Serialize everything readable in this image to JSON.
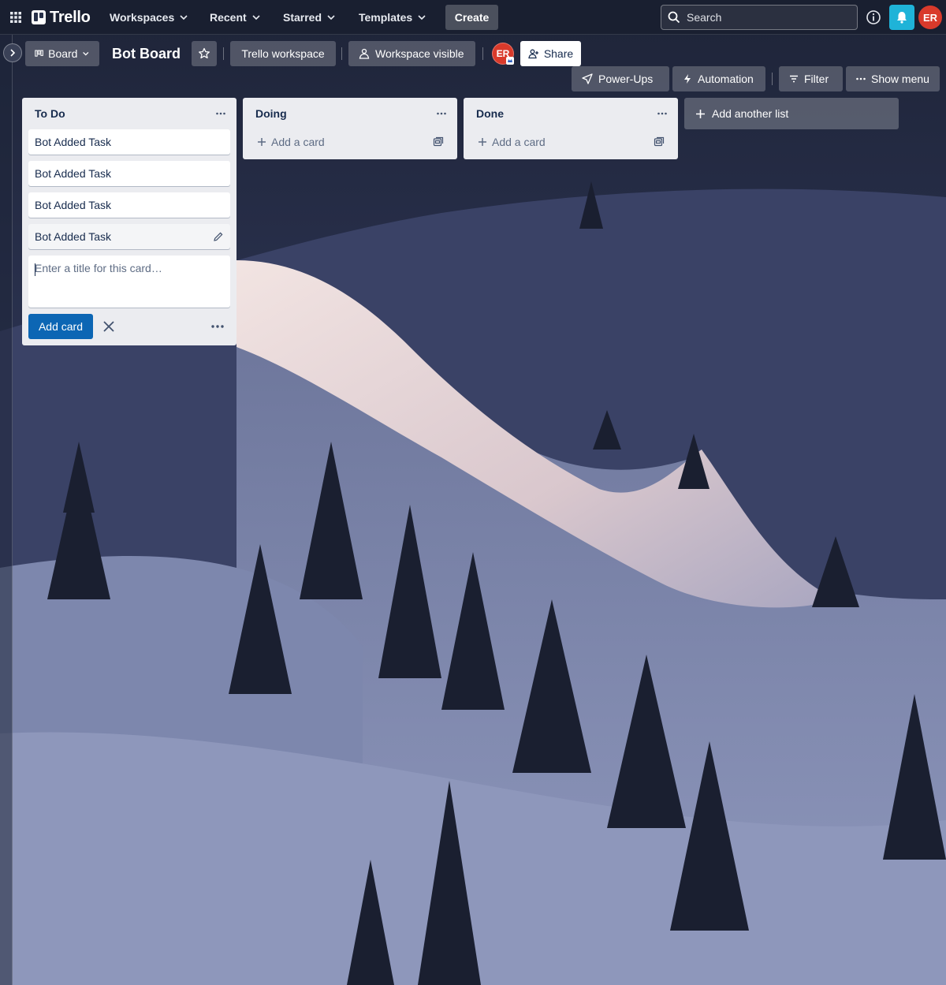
{
  "topnav": {
    "logo_text": "Trello",
    "menus": [
      {
        "label": "Workspaces"
      },
      {
        "label": "Recent"
      },
      {
        "label": "Starred"
      },
      {
        "label": "Templates"
      }
    ],
    "create_label": "Create",
    "search_placeholder": "Search",
    "user_initials": "ER",
    "notification_color": "#1fb3d8",
    "avatar_color": "#d93a2b"
  },
  "board_header": {
    "view_label": "Board",
    "board_name": "Bot Board",
    "workspace_label": "Trello workspace",
    "visibility_label": "Workspace visible",
    "member_initials": "ER",
    "share_label": "Share",
    "powerups_label": "Power-Ups",
    "automation_label": "Automation",
    "filter_label": "Filter",
    "show_menu_label": "Show menu"
  },
  "lists": [
    {
      "title": "To Do",
      "cards": [
        "Bot Added Task",
        "Bot Added Task",
        "Bot Added Task",
        "Bot Added Task"
      ],
      "composer_placeholder": "Enter a title for this card…",
      "add_card_button": "Add card"
    },
    {
      "title": "Doing",
      "add_card_label": "Add a card"
    },
    {
      "title": "Done",
      "add_card_label": "Add a card"
    }
  ],
  "add_list_label": "Add another list",
  "colors": {
    "primary_button": "#0c66b4",
    "list_background": "#ebecf0"
  }
}
